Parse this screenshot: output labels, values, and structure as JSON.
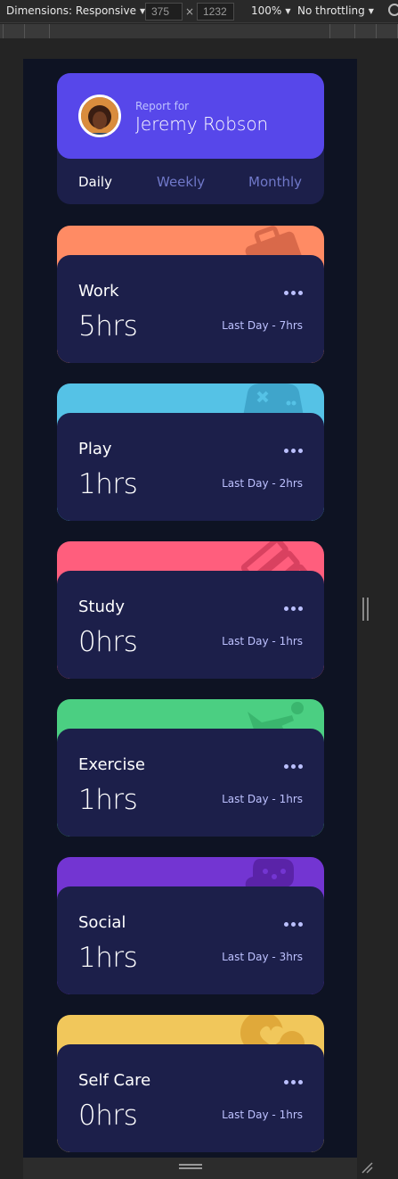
{
  "devtools": {
    "dimensions_label": "Dimensions: Responsive",
    "width_value": "375",
    "height_value": "1232",
    "zoom_label": "100%",
    "throttling_label": "No throttling",
    "separator": "×"
  },
  "profile": {
    "report_for": "Report for",
    "name": "Jeremy Robson",
    "tabs": [
      {
        "label": "Daily",
        "active": true
      },
      {
        "label": "Weekly",
        "active": false
      },
      {
        "label": "Monthly",
        "active": false
      }
    ]
  },
  "cards": [
    {
      "title": "Work",
      "hours": "5hrs",
      "previous": "Last Day - 7hrs",
      "color": "#ff8b64",
      "icon": "briefcase-icon"
    },
    {
      "title": "Play",
      "hours": "1hrs",
      "previous": "Last Day - 2hrs",
      "color": "#55c2e6",
      "icon": "gamepad-icon"
    },
    {
      "title": "Study",
      "hours": "0hrs",
      "previous": "Last Day - 1hrs",
      "color": "#ff5e7d",
      "icon": "books-icon"
    },
    {
      "title": "Exercise",
      "hours": "1hrs",
      "previous": "Last Day - 1hrs",
      "color": "#4bcf82",
      "icon": "runner-icon"
    },
    {
      "title": "Social",
      "hours": "1hrs",
      "previous": "Last Day - 3hrs",
      "color": "#7335d2",
      "icon": "chat-icon"
    },
    {
      "title": "Self Care",
      "hours": "0hrs",
      "previous": "Last Day - 1hrs",
      "color": "#f1c75b",
      "icon": "heart-icon"
    }
  ]
}
